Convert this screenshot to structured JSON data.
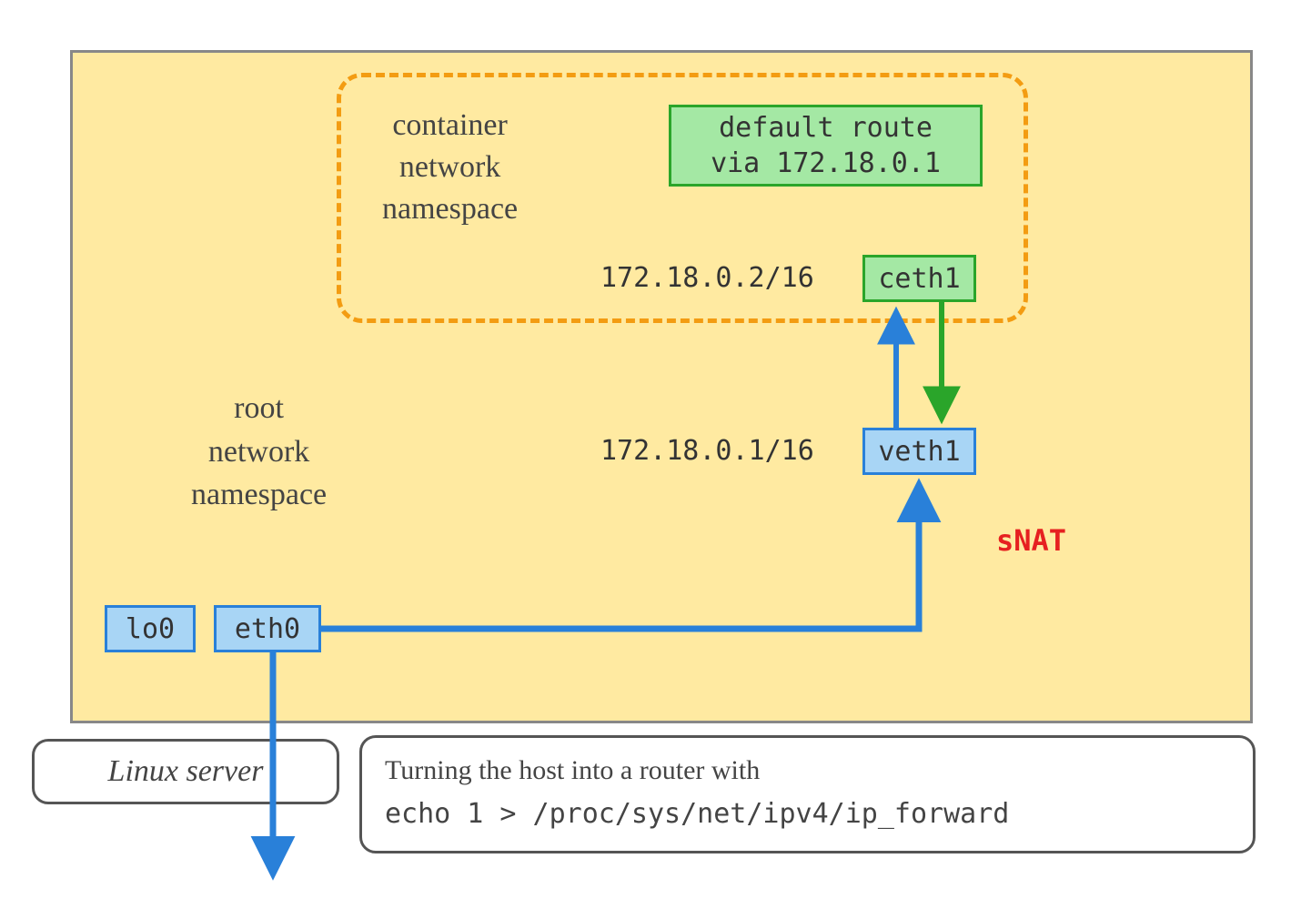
{
  "container_ns": {
    "label_line1": "container",
    "label_line2": "network",
    "label_line3": "namespace",
    "route_line1": "default route",
    "route_line2": "via 172.18.0.1",
    "ceth_label": "ceth1",
    "ceth_ip": "172.18.0.2/16"
  },
  "root_ns": {
    "label_line1": "root",
    "label_line2": "network",
    "label_line3": "namespace",
    "veth_label": "veth1",
    "veth_ip": "172.18.0.1/16",
    "lo_label": "lo0",
    "eth_label": "eth0",
    "snat_label": "sNAT"
  },
  "server_label": "Linux server",
  "router_note": {
    "line1": "Turning the host into a router with",
    "line2": "echo 1 > /proc/sys/net/ipv4/ip_forward"
  }
}
